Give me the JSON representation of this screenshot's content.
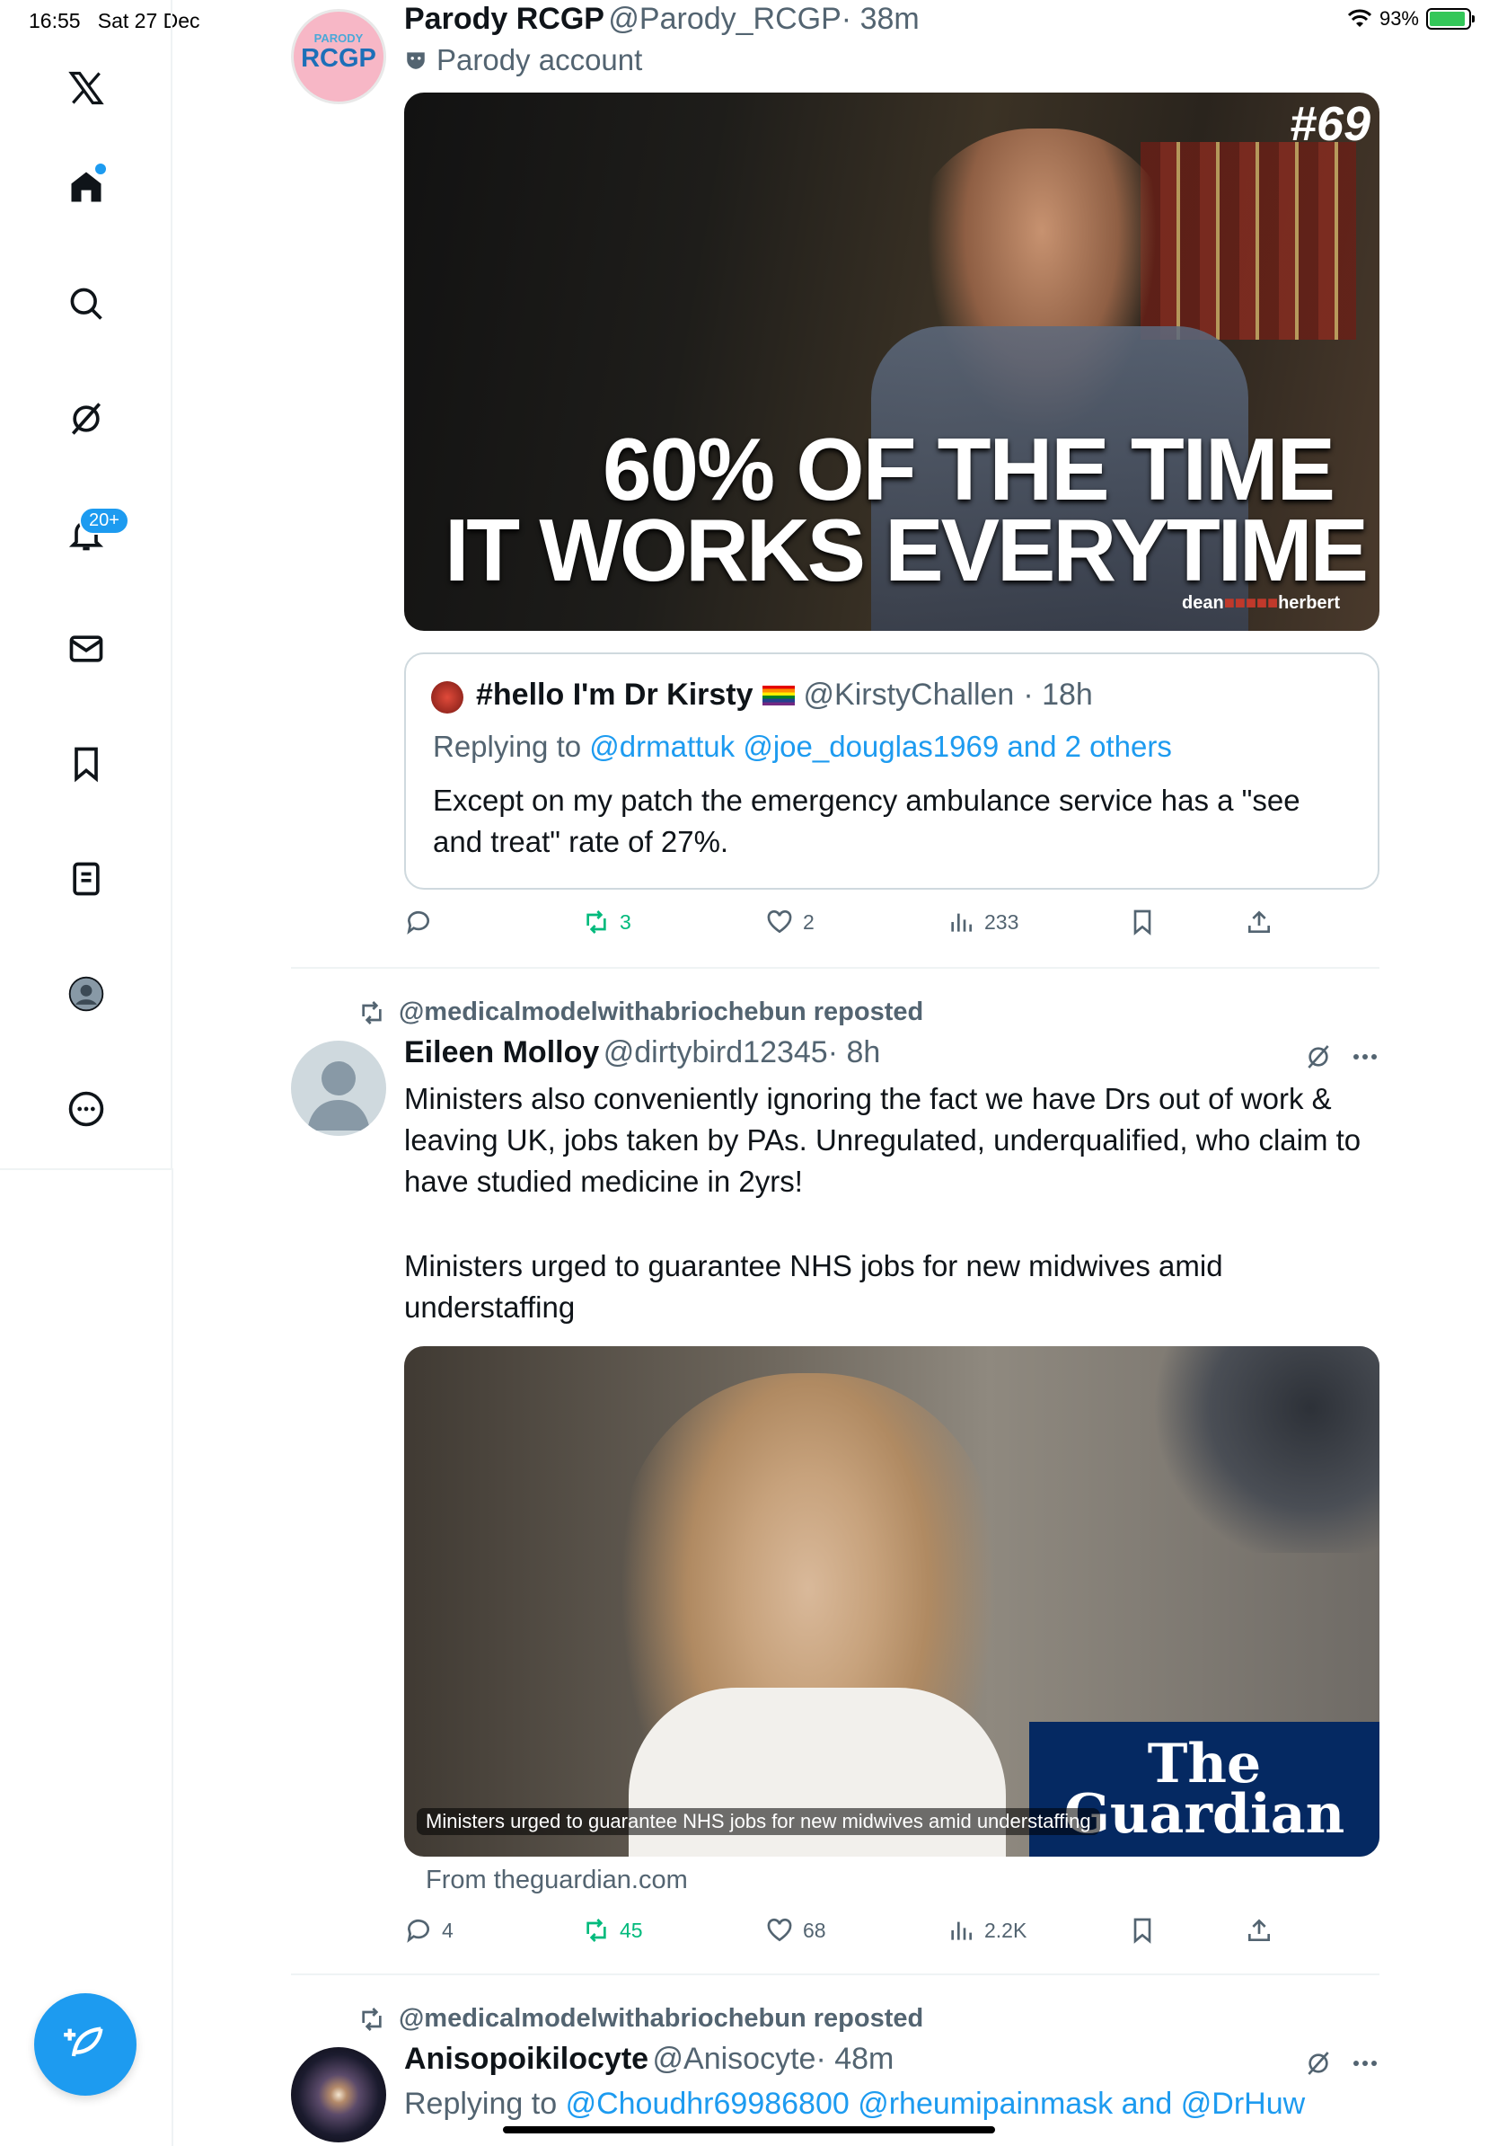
{
  "status": {
    "time": "16:55",
    "date": "Sat 27 Dec",
    "battery": "93%"
  },
  "sidebar": {
    "notifications_badge": "20+"
  },
  "tweet1": {
    "avatar_top": "PARODY",
    "avatar_text": "RCGP",
    "name": "Parody RCGP",
    "handle": "@Parody_RCGP",
    "time": "· 38m",
    "label": "Parody account",
    "image": {
      "number": "#69",
      "line1": "60% OF THE TIME",
      "line2": "IT WORKS EVERYTIME",
      "credit_left": "dean",
      "credit_right": "herbert"
    },
    "quote": {
      "name": "#hello I'm Dr Kirsty",
      "handle": "@KirstyChallen",
      "time": "· 18h",
      "replying_label": "Replying to",
      "replying_to": "@drmattuk @joe_douglas1969 and 2 others",
      "text": "Except on my patch the emergency ambulance service has a \"see and treat\" rate of 27%."
    },
    "actions": {
      "replies": "",
      "reposts": "3",
      "likes": "2",
      "views": "233"
    }
  },
  "tweet2": {
    "repost_label": "@medicalmodelwithabriochebun reposted",
    "name": "Eileen Molloy",
    "handle": "@dirtybird12345",
    "time": "· 8h",
    "text1": "Ministers also conveniently ignoring the fact we have Drs out of work & leaving UK, jobs taken by PAs. Unregulated, underqualified, who claim to have studied medicine in 2yrs!",
    "text2": "Ministers urged to guarantee NHS jobs for new midwives amid understaffing",
    "card": {
      "caption": "Ministers urged to guarantee NHS jobs for new midwives amid understaffing",
      "brand_line1": "The",
      "brand_line2": "Guardian",
      "source": "From theguardian.com"
    },
    "actions": {
      "replies": "4",
      "reposts": "45",
      "likes": "68",
      "views": "2.2K"
    }
  },
  "tweet3": {
    "repost_label": "@medicalmodelwithabriochebun reposted",
    "name": "Anisopoikilocyte",
    "handle": "@Anisocyte",
    "time": "· 48m",
    "replying_label": "Replying to",
    "replying_to": "@Choudhr69986800 @rheumipainmask and @DrHuw"
  },
  "colors": {
    "accent": "#1d9bf0",
    "repost_green": "#00ba7c",
    "muted": "#536471",
    "guardian_blue": "#052962"
  }
}
